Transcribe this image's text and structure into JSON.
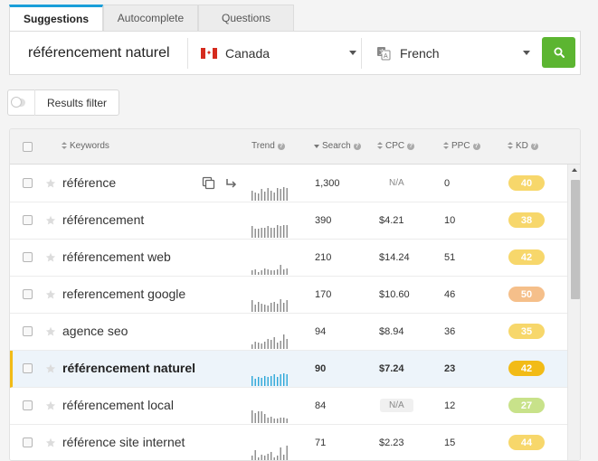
{
  "tabs": [
    {
      "label": "Suggestions",
      "active": true
    },
    {
      "label": "Autocomplete",
      "active": false
    },
    {
      "label": "Questions",
      "active": false
    }
  ],
  "search": {
    "keyword_value": "référencement naturel",
    "country": "Canada",
    "country_flag": "canada-flag-icon",
    "language": "French",
    "language_icon": "translate-icon",
    "search_icon": "search-icon"
  },
  "filter": {
    "label": "Results filter",
    "toggle_on": false
  },
  "table": {
    "columns": {
      "keywords": "Keywords",
      "trend": "Trend",
      "search": "Search",
      "cpc": "CPC",
      "ppc": "PPC",
      "kd": "KD"
    },
    "rows": [
      {
        "keyword": "référence",
        "search": "1,300",
        "cpc": "N/A",
        "ppc": "0",
        "kd": "40",
        "kd_color": "#f7d76b",
        "trend": [
          10,
          8,
          7,
          11,
          9,
          12,
          10,
          8,
          12,
          11,
          13,
          12
        ],
        "show_actions": true
      },
      {
        "keyword": "référencement",
        "search": "390",
        "cpc": "$4.21",
        "ppc": "10",
        "kd": "38",
        "kd_color": "#f7d76b",
        "trend": [
          11,
          9,
          9,
          10,
          10,
          11,
          10,
          10,
          12,
          11,
          12,
          12
        ]
      },
      {
        "keyword": "référencement web",
        "search": "210",
        "cpc": "$14.24",
        "ppc": "51",
        "kd": "42",
        "kd_color": "#f7d76b",
        "trend": [
          4,
          5,
          3,
          4,
          6,
          5,
          4,
          4,
          5,
          10,
          5,
          6
        ]
      },
      {
        "keyword": "referencement google",
        "search": "170",
        "cpc": "$10.60",
        "ppc": "46",
        "kd": "50",
        "kd_color": "#f5bf8a",
        "trend": [
          11,
          7,
          10,
          8,
          7,
          6,
          9,
          10,
          8,
          12,
          9,
          11
        ]
      },
      {
        "keyword": "agence seo",
        "search": "94",
        "cpc": "$8.94",
        "ppc": "36",
        "kd": "35",
        "kd_color": "#f7d76b",
        "trend": [
          4,
          7,
          6,
          5,
          7,
          10,
          9,
          11,
          6,
          8,
          14,
          10
        ]
      },
      {
        "keyword": "référencement naturel",
        "search": "90",
        "cpc": "$7.24",
        "ppc": "23",
        "kd": "42",
        "kd_color": "#f2bb16",
        "trend": [
          10,
          7,
          9,
          8,
          10,
          9,
          10,
          11,
          9,
          11,
          12,
          11
        ],
        "highlighted": true
      },
      {
        "keyword": "référencement local",
        "search": "84",
        "cpc": "N/A",
        "ppc": "12",
        "kd": "27",
        "kd_color": "#c8e28a",
        "trend": [
          12,
          10,
          11,
          11,
          9,
          5,
          6,
          4,
          4,
          5,
          5,
          4
        ],
        "cpc_pill": true
      },
      {
        "keyword": "référence site internet",
        "search": "71",
        "cpc": "$2.23",
        "ppc": "15",
        "kd": "44",
        "kd_color": "#f7d76b",
        "trend": [
          4,
          10,
          3,
          5,
          4,
          6,
          8,
          3,
          4,
          12,
          5,
          14
        ]
      }
    ]
  }
}
